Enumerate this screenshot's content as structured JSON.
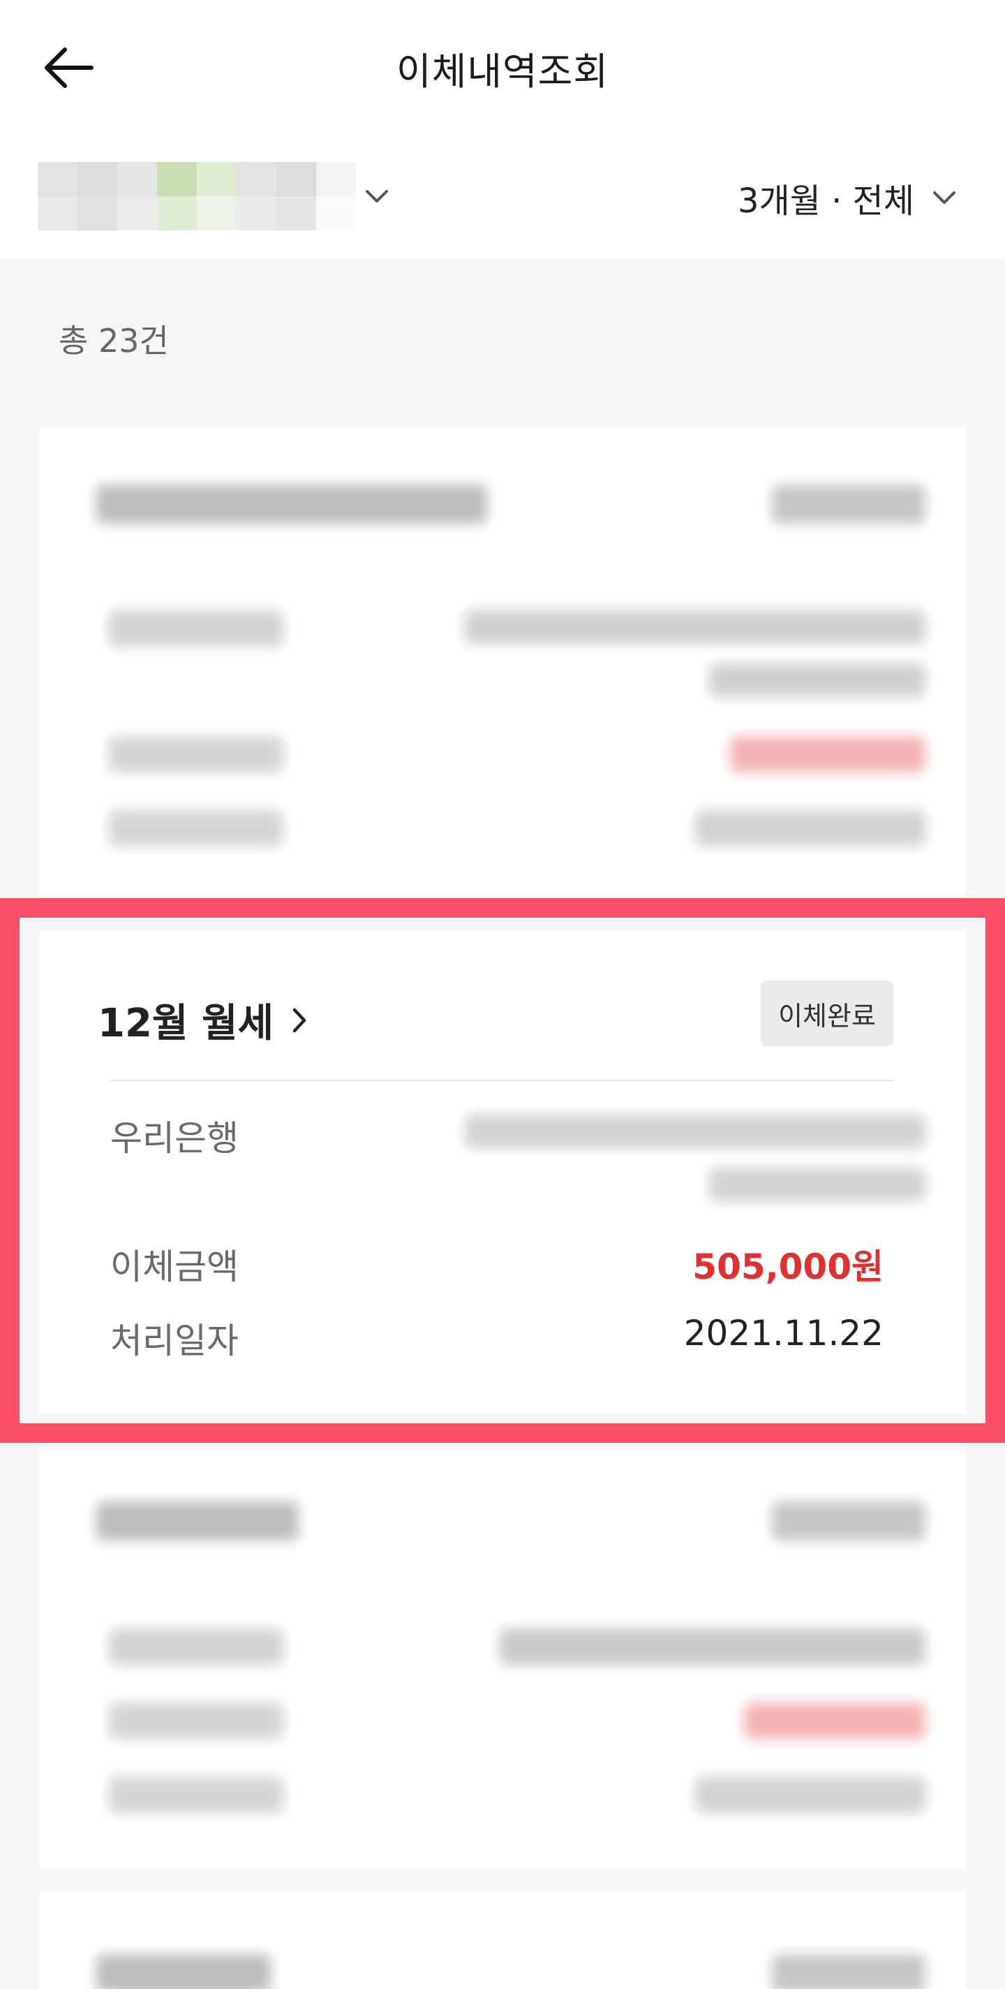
{
  "header": {
    "title": "이체내역조회",
    "back_icon": "back-arrow-icon"
  },
  "filters": {
    "period_label": "3개월 · 전체"
  },
  "summary": {
    "total_text": "총 23건"
  },
  "highlight_color": "#fb4d68",
  "detail": {
    "title": "12월 월세",
    "status_badge": "이체완료",
    "bank_label": "우리은행",
    "amount_label": "이체금액",
    "amount_value": "505,000원",
    "date_label": "처리일자",
    "date_value": "2021.11.22"
  },
  "colors": {
    "amount_red": "#e03131",
    "background": "#f6f6f6",
    "card": "#ffffff"
  }
}
